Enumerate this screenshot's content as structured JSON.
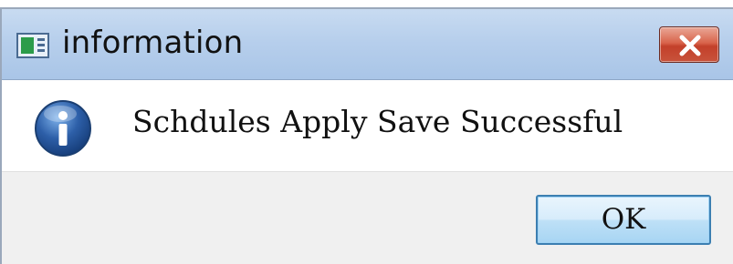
{
  "window": {
    "title": "information",
    "app_icon": "window-app-icon",
    "close_icon": "close-x-icon"
  },
  "message": {
    "icon": "info-icon",
    "text": "Schdules Apply Save Successful"
  },
  "footer": {
    "ok_label": "OK"
  },
  "colors": {
    "titlebar": "#b7cfec",
    "close_button": "#d9644b",
    "footer_background": "#f0f0f0",
    "ok_button_border": "#3c7fb1",
    "info_icon": "#2d5fa8"
  }
}
